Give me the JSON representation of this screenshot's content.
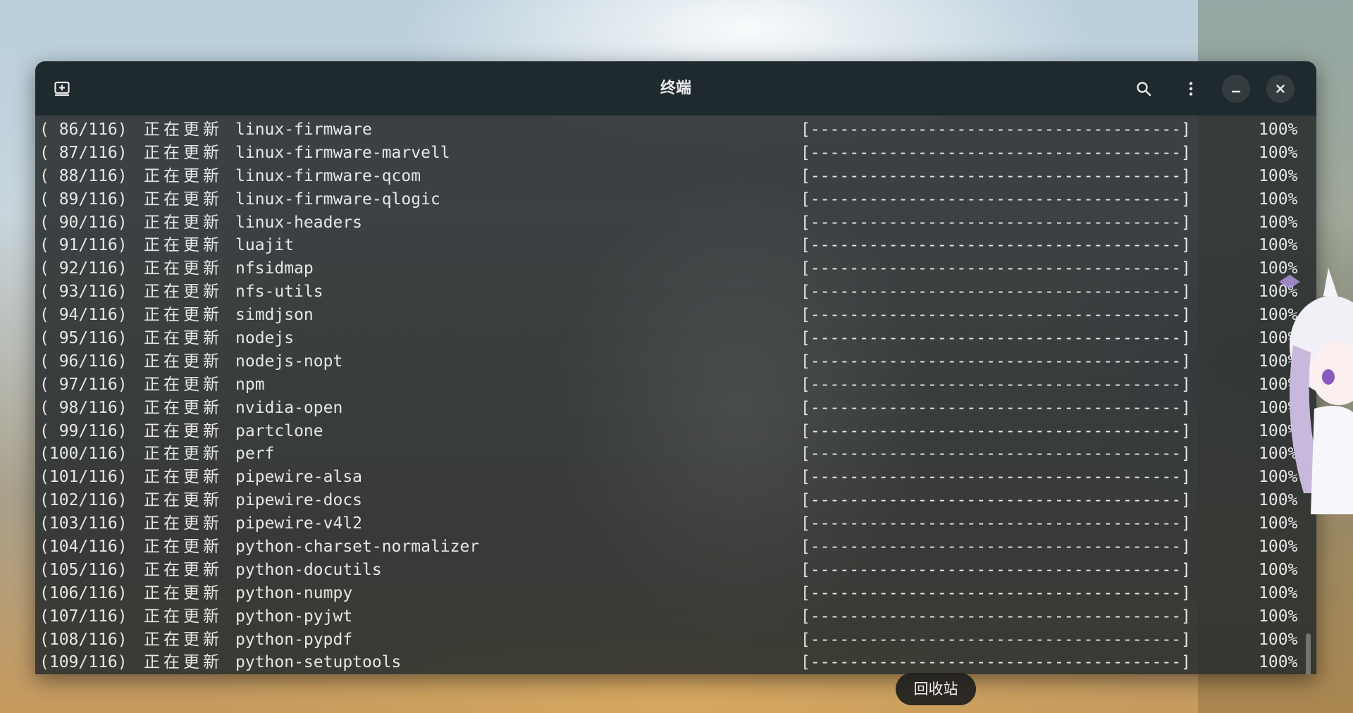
{
  "window": {
    "title": "终端"
  },
  "header": {
    "icons": {
      "new_tab": "new-tab-icon",
      "search": "search-icon",
      "menu": "kebab-menu-icon",
      "minimize": "minimize-icon",
      "close": "close-icon"
    }
  },
  "terminal": {
    "action_text": "正在更新",
    "progress_bar": "[--------------------------------------]",
    "lines": [
      {
        "count": "( 86/116)",
        "package": "linux-firmware",
        "percent": "100%"
      },
      {
        "count": "( 87/116)",
        "package": "linux-firmware-marvell",
        "percent": "100%"
      },
      {
        "count": "( 88/116)",
        "package": "linux-firmware-qcom",
        "percent": "100%"
      },
      {
        "count": "( 89/116)",
        "package": "linux-firmware-qlogic",
        "percent": "100%"
      },
      {
        "count": "( 90/116)",
        "package": "linux-headers",
        "percent": "100%"
      },
      {
        "count": "( 91/116)",
        "package": "luajit",
        "percent": "100%"
      },
      {
        "count": "( 92/116)",
        "package": "nfsidmap",
        "percent": "100%"
      },
      {
        "count": "( 93/116)",
        "package": "nfs-utils",
        "percent": "100%"
      },
      {
        "count": "( 94/116)",
        "package": "simdjson",
        "percent": "100%"
      },
      {
        "count": "( 95/116)",
        "package": "nodejs",
        "percent": "100%"
      },
      {
        "count": "( 96/116)",
        "package": "nodejs-nopt",
        "percent": "100%"
      },
      {
        "count": "( 97/116)",
        "package": "npm",
        "percent": "100%"
      },
      {
        "count": "( 98/116)",
        "package": "nvidia-open",
        "percent": "100%"
      },
      {
        "count": "( 99/116)",
        "package": "partclone",
        "percent": "100%"
      },
      {
        "count": "(100/116)",
        "package": "perf",
        "percent": "100%"
      },
      {
        "count": "(101/116)",
        "package": "pipewire-alsa",
        "percent": "100%"
      },
      {
        "count": "(102/116)",
        "package": "pipewire-docs",
        "percent": "100%"
      },
      {
        "count": "(103/116)",
        "package": "pipewire-v4l2",
        "percent": "100%"
      },
      {
        "count": "(104/116)",
        "package": "python-charset-normalizer",
        "percent": "100%"
      },
      {
        "count": "(105/116)",
        "package": "python-docutils",
        "percent": "100%"
      },
      {
        "count": "(106/116)",
        "package": "python-numpy",
        "percent": "100%"
      },
      {
        "count": "(107/116)",
        "package": "python-pyjwt",
        "percent": "100%"
      },
      {
        "count": "(108/116)",
        "package": "python-pypdf",
        "percent": "100%"
      },
      {
        "count": "(109/116)",
        "package": "python-setuptools",
        "percent": "100%"
      }
    ]
  },
  "dock": {
    "tooltip": "回收站"
  }
}
